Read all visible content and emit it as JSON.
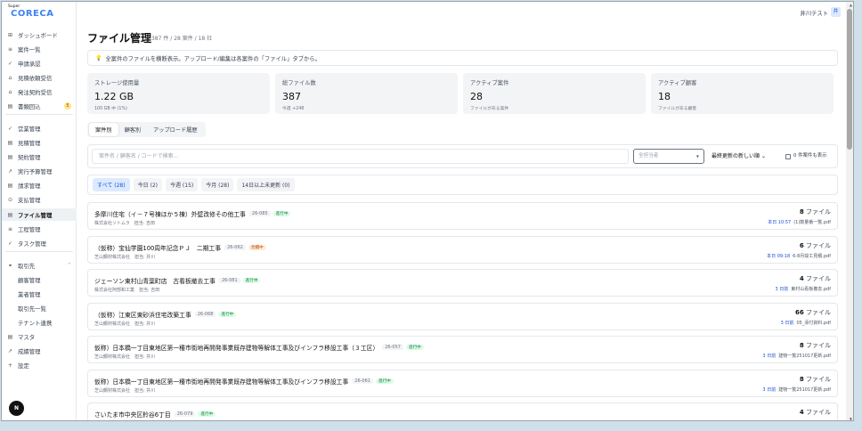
{
  "app": {
    "brand_small": "Super",
    "brand": "CORECA"
  },
  "header": {
    "user_name": "井川テスト",
    "avatar_text": "井"
  },
  "sidebar": {
    "items": [
      {
        "label": "ダッシュボード",
        "icon": "⊞"
      },
      {
        "label": "案件一覧",
        "icon": "≡"
      },
      {
        "label": "申請承認",
        "icon": "✓"
      },
      {
        "label": "見積依頼受信",
        "icon": "⌂"
      },
      {
        "label": "発注契約受信",
        "icon": "⌂"
      },
      {
        "label": "書類回込",
        "icon": "▤",
        "badge": "5"
      },
      {
        "label": "営業管理",
        "icon": "✓"
      },
      {
        "label": "見積管理",
        "icon": "▤"
      },
      {
        "label": "契約管理",
        "icon": "▤"
      },
      {
        "label": "実行予算管理",
        "icon": "↗"
      },
      {
        "label": "請求管理",
        "icon": "▤"
      },
      {
        "label": "支払管理",
        "icon": "⊙"
      },
      {
        "label": "ファイル管理",
        "icon": "▤"
      },
      {
        "label": "工程管理",
        "icon": "≡"
      },
      {
        "label": "タスク管理",
        "icon": "✓"
      },
      {
        "label": "取引先",
        "icon": "⚭"
      },
      {
        "label": "顧客管理"
      },
      {
        "label": "業者管理"
      },
      {
        "label": "取引先一覧"
      },
      {
        "label": "テナント連携"
      },
      {
        "label": "マスタ",
        "icon": "▤"
      },
      {
        "label": "成績管理",
        "icon": "↗"
      },
      {
        "label": "設定",
        "icon": "+"
      }
    ],
    "user_initial": "N"
  },
  "page": {
    "title": "ファイル管理",
    "subtitle": "387 件 / 28 案件 / 18 社",
    "notice": "全案件のファイルを横断表示。アップロード/編集は各案件の「ファイル」タブから。"
  },
  "stats": [
    {
      "label": "ストレージ使用量",
      "value": "1.22 GB",
      "sub": "100 GB 中 (1%)"
    },
    {
      "label": "総ファイル数",
      "value": "387",
      "sub": "今週 +248"
    },
    {
      "label": "アクティブ案件",
      "value": "28",
      "sub": "ファイルがある案件"
    },
    {
      "label": "アクティブ顧客",
      "value": "18",
      "sub": "ファイルがある顧客"
    }
  ],
  "tabs": [
    "案件別",
    "顧客別",
    "アップロード履歴"
  ],
  "search": {
    "placeholder": "案件名 / 顧客名 / コードで検索...",
    "assignee_placeholder": "全担当者",
    "sort_value": "最終更新の新しい順",
    "zero_label": "0 件案件も表示"
  },
  "filters": [
    "すべて (28)",
    "今日 (2)",
    "今週 (15)",
    "今月 (28)",
    "14日以上未更新 (0)"
  ],
  "projects": [
    {
      "name": "多摩川住宅（イ－７号棟ほか５棟）外壁改修その他工事",
      "code": "26-085",
      "status": "進行中",
      "status_type": "ongoing",
      "meta": "株式会社ソトムラ　担当: 吉田",
      "count": "8",
      "unit": "ファイル",
      "when": "本日 10:57",
      "file": "(1)数量番一覧.pdf"
    },
    {
      "name": "（仮称）宝仙学園100周年記念ＰＪ　二期工事",
      "code": "26-062",
      "status": "見積中",
      "status_type": "pending",
      "meta": "芝山鋼材株式会社　担当: 井川",
      "count": "6",
      "unit": "ファイル",
      "when": "本日 09:18",
      "file": "6-8月竣工見積.pdf"
    },
    {
      "name": "ジェーソン東村山青葉町店　古看板撤去工事",
      "code": "26-081",
      "status": "進行中",
      "status_type": "ongoing",
      "meta": "株式会社阿部和工業　担当: 吉田",
      "count": "4",
      "unit": "ファイル",
      "when": "3 日前",
      "file": "東村山看板撤去.pdf"
    },
    {
      "name": "（仮称）江東区東砂浜住宅改築工事",
      "code": "26-068",
      "status": "進行中",
      "status_type": "ongoing",
      "meta": "芝山鋼材株式会社　担当: 井川",
      "count": "66",
      "unit": "ファイル",
      "when": "3 日前",
      "file": "05_添付資料.pdf"
    },
    {
      "name": "仮称）日本橋一丁目東地区第一種市街地再開発事業既存建物等解体工事及びインフラ移設工事（３工区）",
      "code": "26-057",
      "status": "進行中",
      "status_type": "ongoing",
      "meta": "芝山鋼材株式会社　担当: 井川",
      "count": "8",
      "unit": "ファイル",
      "when": "3 日前",
      "file": "建物一覧251017更新.pdf"
    },
    {
      "name": "仮称）日本橋一丁目東地区第一種市街地再開発事業既存建物等解体工事及びインフラ移設工事",
      "code": "26-061",
      "status": "進行中",
      "status_type": "ongoing",
      "meta": "芝山鋼材株式会社　担当: 井川",
      "count": "8",
      "unit": "ファイル",
      "when": "3 日前",
      "file": "建物一覧251017更新.pdf"
    },
    {
      "name": "さいたま市中央区鈴谷6丁目",
      "code": "26-079",
      "status": "進行中",
      "status_type": "ongoing",
      "meta": "",
      "count": "4",
      "unit": "ファイル",
      "when": "",
      "file": ""
    }
  ]
}
